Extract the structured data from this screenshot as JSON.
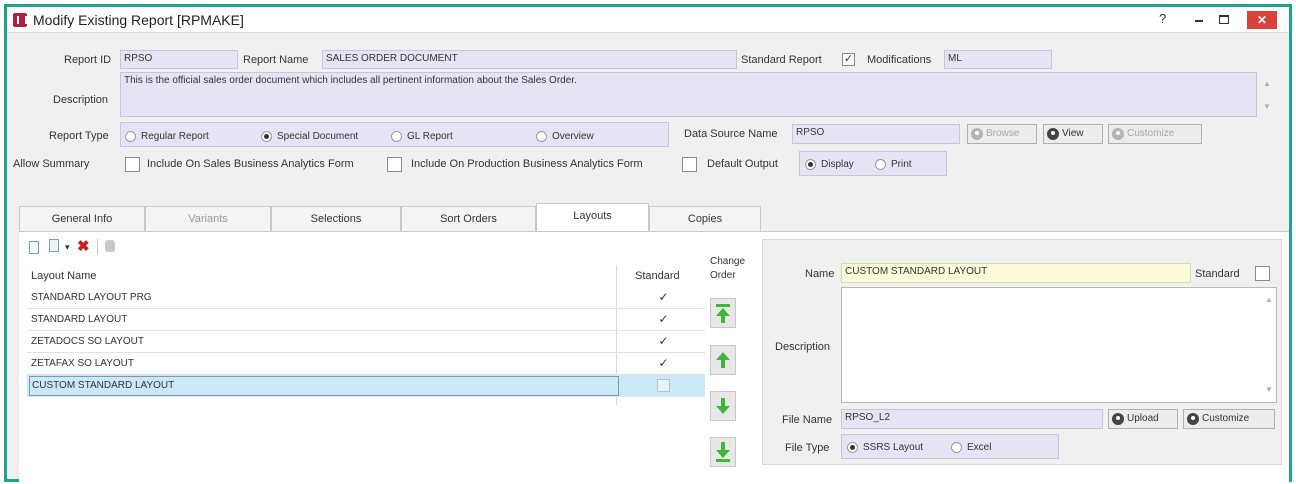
{
  "window": {
    "title": "Modify Existing Report [RPMAKE]",
    "help_glyph": "?",
    "close_glyph": "✕"
  },
  "header": {
    "report_id_label": "Report ID",
    "report_id_value": "RPSO",
    "report_name_label": "Report Name",
    "report_name_value": "SALES ORDER DOCUMENT",
    "standard_report_label": "Standard Report",
    "standard_report_checked": "✓",
    "modifications_label": "Modifications",
    "modifications_value": "ML",
    "description_label": "Description",
    "description_value": "This is the official sales order document which includes all pertinent information about the Sales Order.",
    "report_type_label": "Report Type",
    "report_type_options": [
      "Regular Report",
      "Special Document",
      "GL Report",
      "Overview"
    ],
    "report_type_selected": "Special Document",
    "data_source_label": "Data Source Name",
    "data_source_value": "RPSO",
    "browse_label": "Browse",
    "view_label": "View",
    "customize_label": "Customize",
    "allow_summary_label": "Allow Summary",
    "include_sales_label": "Include On Sales Business Analytics Form",
    "include_production_label": "Include On Production Business Analytics Form",
    "default_output_label": "Default Output",
    "output_options": [
      "Display",
      "Print"
    ],
    "output_selected": "Display"
  },
  "tabs": [
    {
      "label": "General Info"
    },
    {
      "label": "Variants"
    },
    {
      "label": "Selections"
    },
    {
      "label": "Sort Orders"
    },
    {
      "label": "Layouts"
    },
    {
      "label": "Copies"
    }
  ],
  "active_tab": "Layouts",
  "layouts": {
    "col_name": "Layout Name",
    "col_standard": "Standard",
    "change_order_label": "Change Order",
    "rows": [
      {
        "name": "STANDARD LAYOUT PRG",
        "standard": "✓"
      },
      {
        "name": "STANDARD LAYOUT",
        "standard": "✓"
      },
      {
        "name": "ZETADOCS SO LAYOUT",
        "standard": "✓"
      },
      {
        "name": "ZETAFAX SO LAYOUT",
        "standard": "✓"
      },
      {
        "name": "CUSTOM STANDARD LAYOUT",
        "standard": ""
      }
    ],
    "selected_row": "CUSTOM STANDARD LAYOUT"
  },
  "detail": {
    "name_label": "Name",
    "name_value": "CUSTOM STANDARD LAYOUT",
    "standard_label": "Standard",
    "description_label": "Description",
    "description_value": "",
    "file_name_label": "File Name",
    "file_name_value": "RPSO_L2",
    "upload_label": "Upload",
    "customize_label": "Customize",
    "file_type_label": "File Type",
    "file_type_options": [
      "SSRS Layout",
      "Excel"
    ],
    "file_type_selected": "SSRS Layout"
  },
  "colors": {
    "frame": "#1ea38f",
    "field_purple": "#e6e4f4",
    "field_yellow": "#fbfbd9",
    "selection": "#cce8f6",
    "close_red": "#d9413b",
    "arrow_green": "#3fb83a"
  }
}
